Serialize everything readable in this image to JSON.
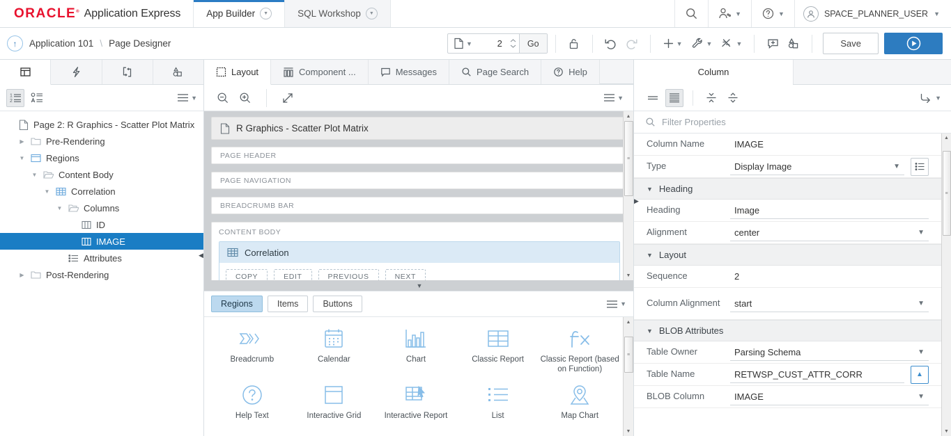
{
  "header": {
    "brand_logo": "ORACLE",
    "brand_name": "Application Express",
    "tabs": [
      {
        "label": "App Builder",
        "active": true
      },
      {
        "label": "SQL Workshop",
        "active": false
      }
    ],
    "icons": [
      "search-icon",
      "users-icon",
      "help-icon"
    ],
    "user": "SPACE_PLANNER_USER"
  },
  "toolbar": {
    "up_icon": "up-arrow-icon",
    "breadcrumb_app": "Application 101",
    "breadcrumb_sep": "\\",
    "breadcrumb_page": "Page Designer",
    "page_number": "2",
    "go_label": "Go",
    "save_label": "Save",
    "run_label": "run-icon",
    "icons": [
      "page-select-icon",
      "lock-icon",
      "undo-icon",
      "redo-icon",
      "add-icon",
      "utilities-icon",
      "shortcuts-icon",
      "comments-icon",
      "theme-icon"
    ]
  },
  "left_panel": {
    "tabs": [
      {
        "name": "rendering-tab",
        "icon": "grid-icon",
        "active": true
      },
      {
        "name": "dynamic-actions-tab",
        "icon": "lightning-icon",
        "active": false
      },
      {
        "name": "processing-tab",
        "icon": "process-icon",
        "active": false
      },
      {
        "name": "shared-components-tab",
        "icon": "shapes-icon",
        "active": false
      }
    ],
    "controls": [
      {
        "name": "sort-numeric-button",
        "icon": "sort-numeric-icon",
        "pressed": true
      },
      {
        "name": "sort-alpha-button",
        "icon": "sort-alpha-icon",
        "pressed": false
      }
    ],
    "tree": [
      {
        "label": "Page 2: R Graphics - Scatter Plot Matrix",
        "depth": 0,
        "icon": "page-icon",
        "twisty": "",
        "selected": false
      },
      {
        "label": "Pre-Rendering",
        "depth": 1,
        "icon": "folder-icon",
        "twisty": "collapsed",
        "selected": false
      },
      {
        "label": "Regions",
        "depth": 1,
        "icon": "region-icon",
        "twisty": "expanded",
        "selected": false
      },
      {
        "label": "Content Body",
        "depth": 2,
        "icon": "open-folder-icon",
        "twisty": "expanded",
        "selected": false
      },
      {
        "label": "Correlation",
        "depth": 3,
        "icon": "report-icon",
        "twisty": "expanded",
        "selected": false
      },
      {
        "label": "Columns",
        "depth": 4,
        "icon": "open-folder-icon",
        "twisty": "expanded",
        "selected": false
      },
      {
        "label": "ID",
        "depth": 5,
        "icon": "column-icon",
        "twisty": "",
        "selected": false
      },
      {
        "label": "IMAGE",
        "depth": 5,
        "icon": "column-icon",
        "twisty": "",
        "selected": true
      },
      {
        "label": "Attributes",
        "depth": 4,
        "icon": "attributes-icon",
        "twisty": "",
        "selected": false
      },
      {
        "label": "Post-Rendering",
        "depth": 1,
        "icon": "folder-icon",
        "twisty": "collapsed",
        "selected": false
      }
    ]
  },
  "center_panel": {
    "tabs": [
      {
        "label": "Layout",
        "icon": "layout-icon",
        "active": true
      },
      {
        "label": "Component ...",
        "icon": "component-icon",
        "active": false
      },
      {
        "label": "Messages",
        "icon": "messages-icon",
        "active": false
      },
      {
        "label": "Page Search",
        "icon": "search-icon",
        "active": false
      },
      {
        "label": "Help",
        "icon": "help-icon",
        "active": false
      }
    ],
    "controls": [
      "zoom-out-icon",
      "zoom-in-icon",
      "expand-icon",
      "menu-icon"
    ],
    "stage": {
      "page_title": "R Graphics - Scatter Plot Matrix",
      "slots": [
        "PAGE HEADER",
        "PAGE NAVIGATION",
        "BREADCRUMB BAR"
      ],
      "content_body_label": "CONTENT BODY",
      "region_name": "Correlation",
      "region_buttons": [
        "COPY",
        "EDIT",
        "PREVIOUS",
        "NEXT"
      ]
    },
    "gallery": {
      "tabs": [
        {
          "label": "Regions",
          "active": true
        },
        {
          "label": "Items",
          "active": false
        },
        {
          "label": "Buttons",
          "active": false
        }
      ],
      "items": [
        {
          "label": "Breadcrumb",
          "icon": "breadcrumb-icon"
        },
        {
          "label": "Calendar",
          "icon": "calendar-icon"
        },
        {
          "label": "Chart",
          "icon": "chart-icon"
        },
        {
          "label": "Classic Report",
          "icon": "classic-report-icon"
        },
        {
          "label": "Classic Report (based on Function)",
          "icon": "function-icon"
        },
        {
          "label": "Help Text",
          "icon": "help-text-icon"
        },
        {
          "label": "Interactive Grid",
          "icon": "interactive-grid-icon"
        },
        {
          "label": "Interactive Report",
          "icon": "interactive-report-icon"
        },
        {
          "label": "List",
          "icon": "list-icon"
        },
        {
          "label": "Map Chart",
          "icon": "map-chart-icon"
        }
      ]
    }
  },
  "right_panel": {
    "tab_label": "Column",
    "controls": [
      {
        "name": "show-all-button",
        "icon": "list-compact-icon",
        "pressed": false
      },
      {
        "name": "show-grouped-button",
        "icon": "list-grouped-icon",
        "pressed": true
      },
      {
        "name": "collapse-all-button",
        "icon": "collapse-icon",
        "pressed": false
      },
      {
        "name": "expand-all-button",
        "icon": "expand-icon",
        "pressed": false
      },
      {
        "name": "goto-button",
        "icon": "goto-icon",
        "pressed": false
      }
    ],
    "filter_placeholder": "Filter Properties",
    "properties": [
      {
        "kind": "row",
        "label": "Column Name",
        "value": "IMAGE",
        "control": "text"
      },
      {
        "kind": "row",
        "label": "Type",
        "value": "Display Image",
        "control": "select",
        "extra": "list-button"
      },
      {
        "kind": "section",
        "label": "Heading"
      },
      {
        "kind": "row",
        "label": "Heading",
        "value": "Image",
        "control": "input"
      },
      {
        "kind": "row",
        "label": "Alignment",
        "value": "center",
        "control": "select"
      },
      {
        "kind": "section",
        "label": "Layout"
      },
      {
        "kind": "row",
        "label": "Sequence",
        "value": "2",
        "control": "text"
      },
      {
        "kind": "row",
        "label": "Column Alignment",
        "value": "start",
        "control": "select"
      },
      {
        "kind": "section",
        "label": "BLOB Attributes"
      },
      {
        "kind": "row",
        "label": "Table Owner",
        "value": "Parsing Schema",
        "control": "select"
      },
      {
        "kind": "row",
        "label": "Table Name",
        "value": "RETWSP_CUST_ATTR_CORR",
        "control": "input",
        "extra": "up-button"
      },
      {
        "kind": "row",
        "label": "BLOB Column",
        "value": "IMAGE",
        "control": "select"
      }
    ]
  },
  "colors": {
    "oracle_red": "#e8112d",
    "accent_blue": "#2d7cc0",
    "selection_blue": "#1a7dc4",
    "region_header": "#dbeaf6",
    "gallery_icon": "#87bde8"
  }
}
